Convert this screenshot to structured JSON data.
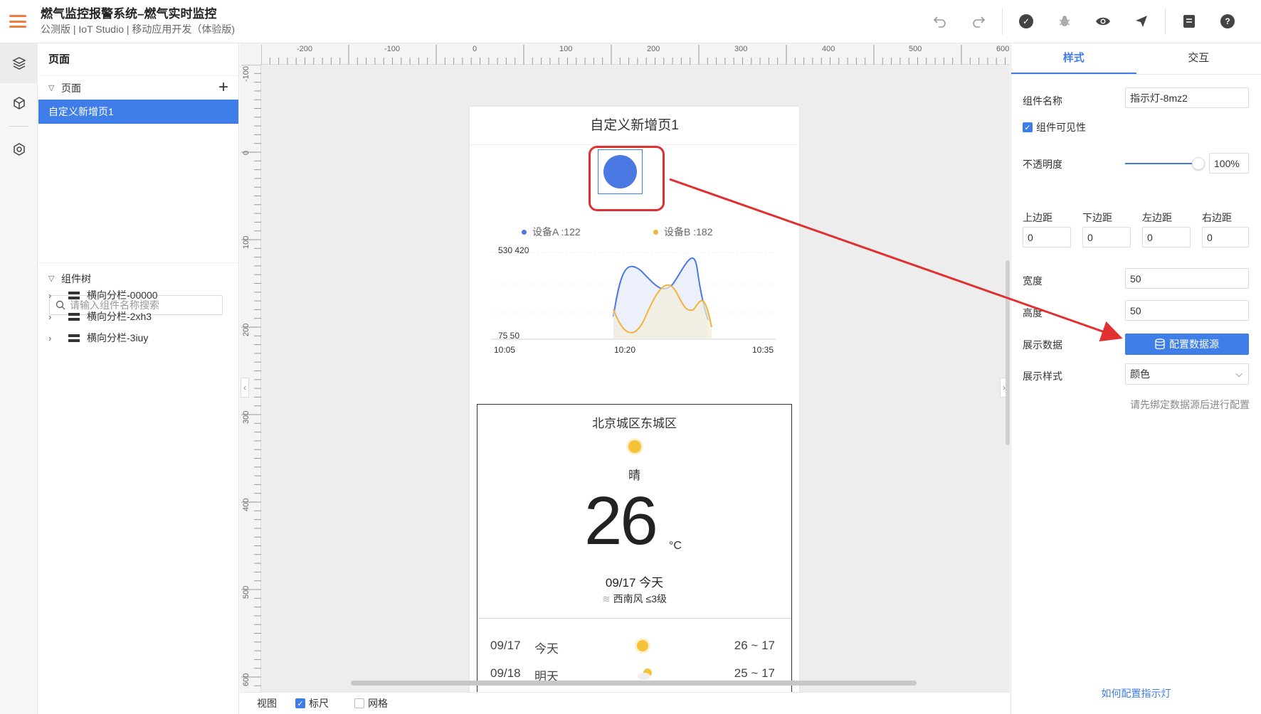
{
  "header": {
    "title": "燃气监控报警系统–燃气实时监控",
    "subtitle": "公测版 | IoT Studio | 移动应用开发（体验版)"
  },
  "left_panel": {
    "title": "页面",
    "pages_section": "页面",
    "pages": [
      "自定义新增页1"
    ],
    "tree_section": "组件树",
    "search_placeholder": "请输入组件名称搜索",
    "tree_items": [
      "横向分栏-00000",
      "横向分栏-2xh3",
      "横向分栏-3iuy"
    ]
  },
  "ruler": {
    "top_labels": [
      "-200",
      "-100",
      "0",
      "100",
      "200",
      "300",
      "400",
      "500",
      "600"
    ],
    "left_labels": [
      "-100",
      "0",
      "100",
      "200",
      "300",
      "400",
      "500",
      "600"
    ]
  },
  "phone": {
    "title": "自定义新增页1",
    "legend": [
      {
        "label": "设备A :122",
        "color": "#4a79e4"
      },
      {
        "label": "设备B :182",
        "color": "#f0b43c"
      }
    ],
    "y_tick_top": "530  420",
    "y_tick_bottom": "75  50",
    "x_ticks": [
      "10:05",
      "10:20",
      "10:35"
    ],
    "weather": {
      "city": "北京城区东城区",
      "condition": "晴",
      "temperature": "26",
      "unit": "°C",
      "date": "09/17 今天",
      "wind": "西南风  ≤3级",
      "forecast": [
        {
          "date": "09/17",
          "day": "今天",
          "range": "26 ~ 17"
        },
        {
          "date": "09/18",
          "day": "明天",
          "range": "25 ~ 17"
        }
      ]
    }
  },
  "bottom_bar": {
    "view_label": "视图",
    "ruler_label": "标尺",
    "grid_label": "网格"
  },
  "right_panel": {
    "tabs": [
      "样式",
      "交互"
    ],
    "component_name_label": "组件名称",
    "component_name_value": "指示灯-8mz2",
    "visible_label": "组件可见性",
    "opacity_label": "不透明度",
    "opacity_value": "100%",
    "margin_labels": [
      "上边距",
      "下边距",
      "左边距",
      "右边距"
    ],
    "margin_values": [
      "0",
      "0",
      "0",
      "0"
    ],
    "width_label": "宽度",
    "width_value": "50",
    "height_label": "高度",
    "height_value": "50",
    "display_data_label": "展示数据",
    "config_button": "配置数据源",
    "display_style_label": "展示样式",
    "display_style_value": "颜色",
    "hint": "请先绑定数据源后进行配置",
    "help_link": "如何配置指示灯"
  },
  "colors": {
    "accent": "#3f7ee8",
    "indicator": "#4a79e4",
    "series_a": "#4a79e4",
    "series_b": "#f0b43c",
    "annotation": "#e03030"
  }
}
